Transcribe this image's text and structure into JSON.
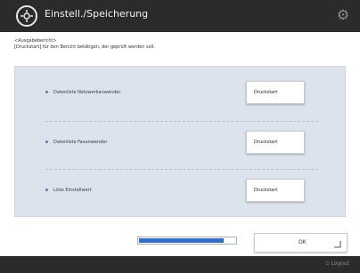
{
  "header": {
    "title": "Einstell./Speicherung"
  },
  "description": {
    "line1": "<Ausgabebericht>",
    "line2": "[Druckstart] für den Bericht betätigen, der geprüft werden soll."
  },
  "items": [
    {
      "label": "Datenliste Netzwerkanwender",
      "button": "Druckstart"
    },
    {
      "label": "Datenliste Faxanwender",
      "button": "Druckstart"
    },
    {
      "label": "Liste Einstellwert",
      "button": "Druckstart"
    }
  ],
  "progress": {
    "value": 0.88
  },
  "footer": {
    "ok_label": "OK",
    "logout_label": "Logout"
  },
  "colors": {
    "accent": "#2f6fd1",
    "bar": "#2b2b2b",
    "panel": "#dde3ec"
  }
}
